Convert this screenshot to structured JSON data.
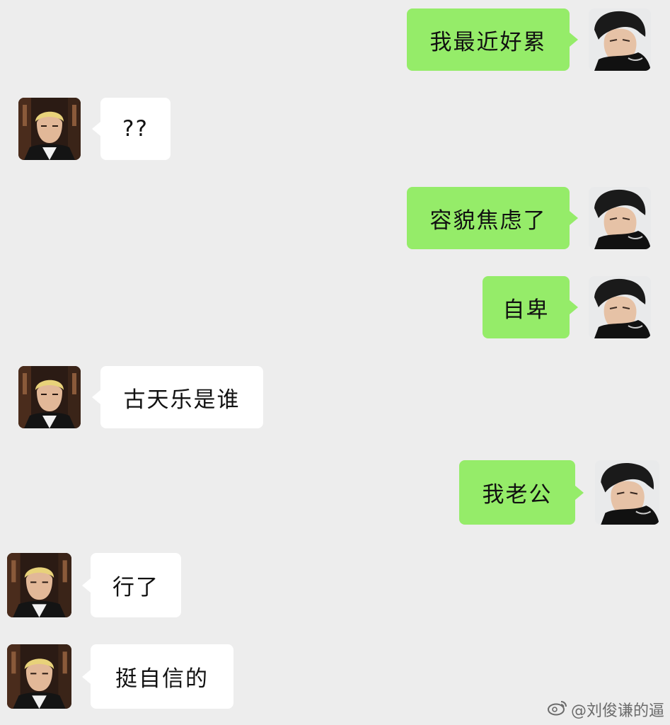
{
  "messages": [
    {
      "side": "me",
      "text": "我最近好累"
    },
    {
      "side": "them",
      "text": "??"
    },
    {
      "side": "me",
      "text": "容貌焦虑了"
    },
    {
      "side": "me",
      "text": "自卑"
    },
    {
      "side": "them",
      "text": "古天乐是谁"
    },
    {
      "side": "me",
      "text": "我老公"
    },
    {
      "side": "them",
      "text": "行了"
    },
    {
      "side": "them",
      "text": "挺自信的"
    }
  ],
  "watermark": {
    "text": "@刘俊谦的逼",
    "icon": "weibo-icon"
  },
  "colors": {
    "background": "#ededed",
    "me_bubble": "#95ec69",
    "them_bubble": "#ffffff"
  }
}
